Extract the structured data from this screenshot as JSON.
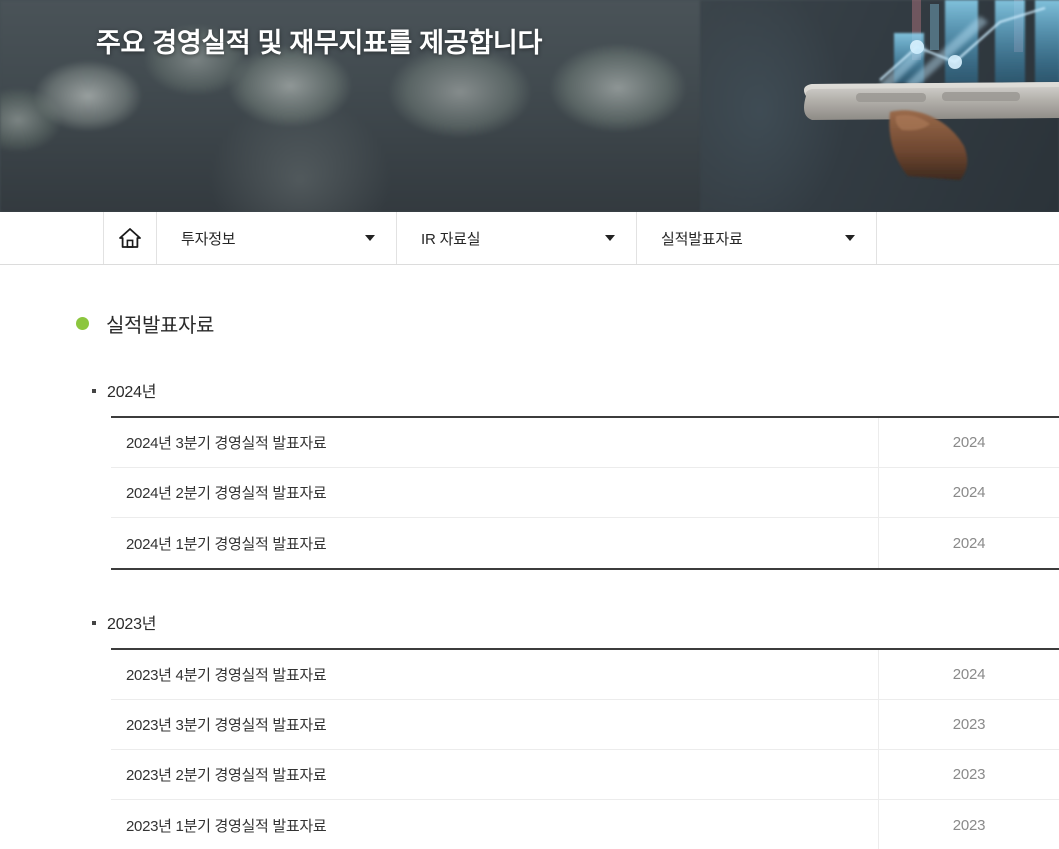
{
  "banner": {
    "title": "주요 경영실적 및 재무지표를 제공합니다",
    "background_color": "#434d52",
    "accent_color": "#4fb9e8",
    "image_description": "holographic-bar-chart-over-smartphone"
  },
  "nav": {
    "home_icon": "home-icon",
    "items": [
      {
        "label": "투자정보",
        "caret": "chevron-down-icon"
      },
      {
        "label": "IR 자료실",
        "caret": "chevron-down-icon"
      },
      {
        "label": "실적발표자료",
        "caret": "chevron-down-icon"
      }
    ]
  },
  "page": {
    "bullet_color": "#8cc63e",
    "title": "실적발표자료"
  },
  "sections": [
    {
      "year_label": "2024년",
      "rows": [
        {
          "title": "2024년 3분기 경영실적 발표자료",
          "date": "2024"
        },
        {
          "title": "2024년 2분기 경영실적 발표자료",
          "date": "2024"
        },
        {
          "title": "2024년 1분기 경영실적 발표자료",
          "date": "2024"
        }
      ]
    },
    {
      "year_label": "2023년",
      "rows": [
        {
          "title": "2023년 4분기 경영실적 발표자료",
          "date": "2024"
        },
        {
          "title": "2023년 3분기 경영실적 발표자료",
          "date": "2023"
        },
        {
          "title": "2023년 2분기 경영실적 발표자료",
          "date": "2023"
        },
        {
          "title": "2023년 1분기 경영실적 발표자료",
          "date": "2023"
        }
      ]
    }
  ]
}
